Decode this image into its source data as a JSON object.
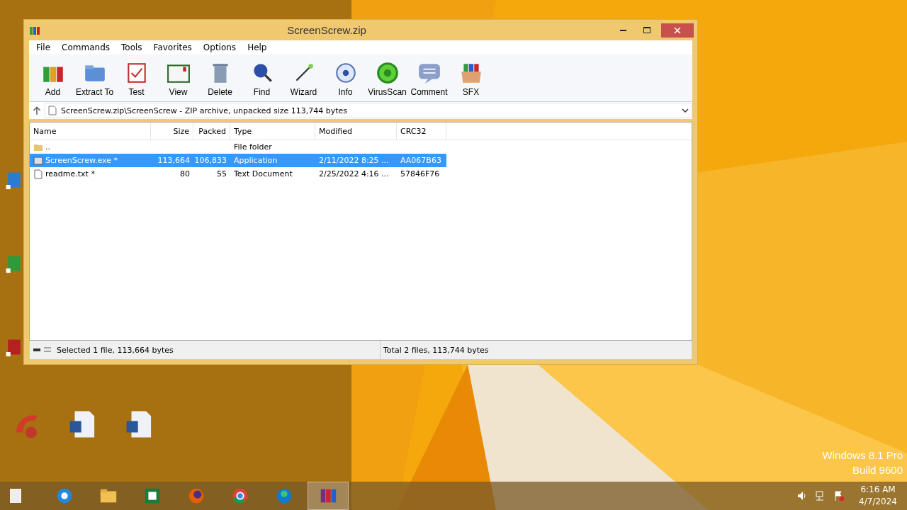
{
  "window": {
    "title": "ScreenScrew.zip"
  },
  "menu": [
    "File",
    "Commands",
    "Tools",
    "Favorites",
    "Options",
    "Help"
  ],
  "toolbar": [
    {
      "label": "Add",
      "kind": "add"
    },
    {
      "label": "Extract To",
      "kind": "extract"
    },
    {
      "label": "Test",
      "kind": "test"
    },
    {
      "label": "View",
      "kind": "view"
    },
    {
      "label": "Delete",
      "kind": "delete"
    },
    {
      "label": "Find",
      "kind": "find"
    },
    {
      "label": "Wizard",
      "kind": "wizard"
    },
    {
      "label": "Info",
      "kind": "info"
    },
    {
      "label": "VirusScan",
      "kind": "virus"
    },
    {
      "label": "Comment",
      "kind": "comment"
    },
    {
      "label": "SFX",
      "kind": "sfx"
    }
  ],
  "path": "ScreenScrew.zip\\ScreenScrew - ZIP archive, unpacked size 113,744 bytes",
  "columns": [
    "Name",
    "Size",
    "Packed",
    "Type",
    "Modified",
    "CRC32"
  ],
  "rows": [
    {
      "kind": "folder",
      "name": "..",
      "type": "File folder",
      "selected": false
    },
    {
      "kind": "app",
      "name": "ScreenScrew.exe *",
      "size": "113,664",
      "packed": "106,833",
      "type": "Application",
      "modified": "2/11/2022 8:25 ...",
      "crc": "AA067B63",
      "selected": true
    },
    {
      "kind": "text",
      "name": "readme.txt *",
      "size": "80",
      "packed": "55",
      "type": "Text Document",
      "modified": "2/25/2022 4:16 ...",
      "crc": "57846F76",
      "selected": false
    }
  ],
  "status": {
    "selected": "Selected 1 file, 113,664 bytes",
    "total": "Total 2 files, 113,744 bytes"
  },
  "os_info": [
    "Windows 8.1 Pro",
    "Build 9600"
  ],
  "taskbar": [
    {
      "kind": "ie",
      "active": false
    },
    {
      "kind": "explorer",
      "active": false
    },
    {
      "kind": "sheet",
      "active": false
    },
    {
      "kind": "firefox",
      "active": false
    },
    {
      "kind": "chrome",
      "active": false
    },
    {
      "kind": "edge",
      "active": false
    },
    {
      "kind": "winrar",
      "active": true
    }
  ],
  "clock": {
    "time": "6:16 AM",
    "date": "4/7/2024"
  }
}
